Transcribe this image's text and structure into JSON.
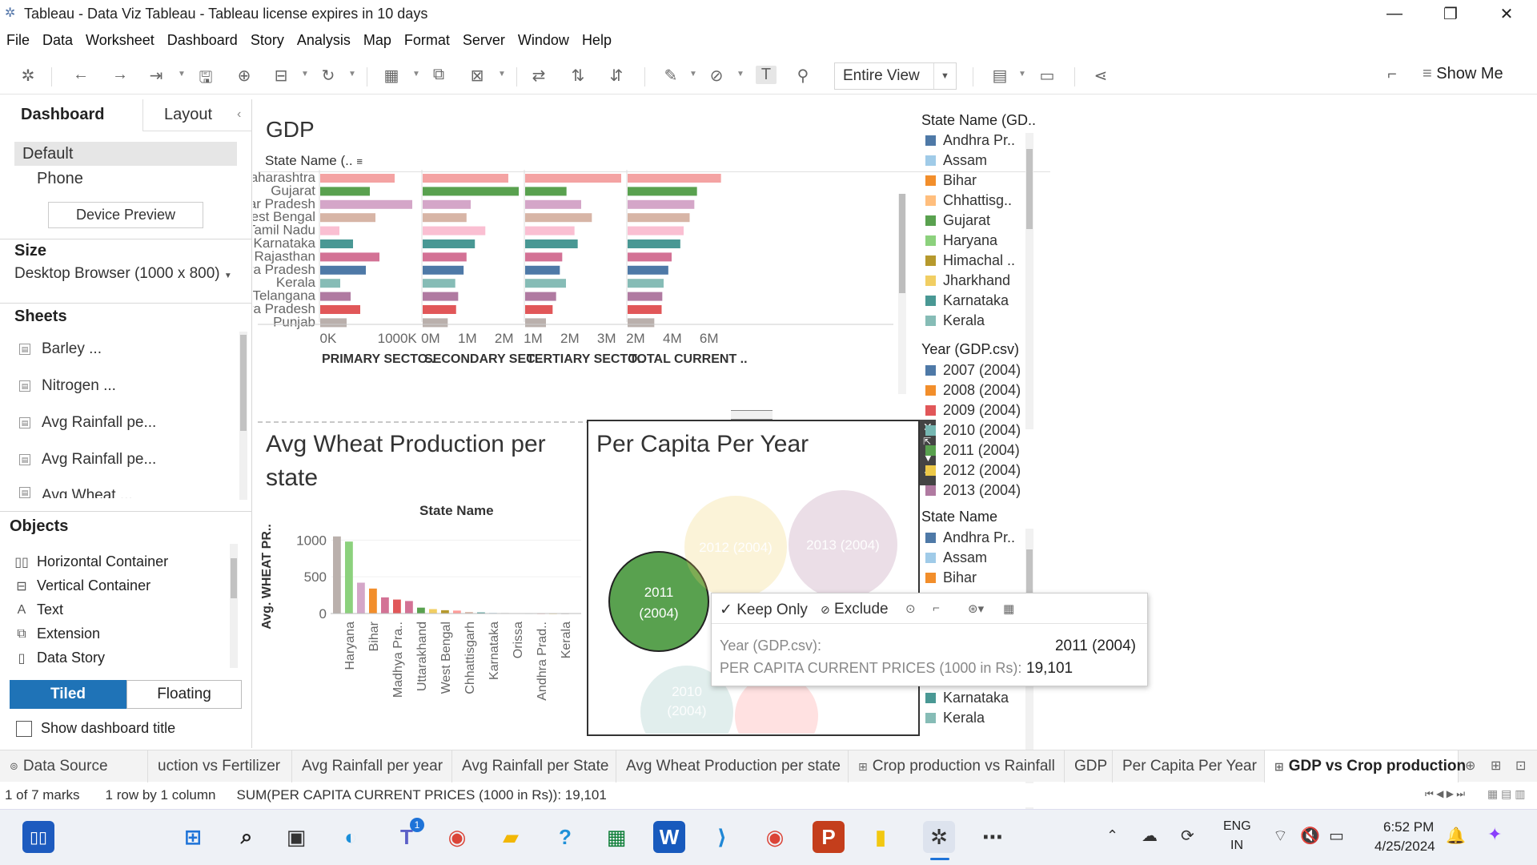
{
  "window": {
    "title": "Tableau - Data Viz Tableau - Tableau license expires in 10 days"
  },
  "menu": [
    "File",
    "Data",
    "Worksheet",
    "Dashboard",
    "Story",
    "Analysis",
    "Map",
    "Format",
    "Server",
    "Window",
    "Help"
  ],
  "toolbar": {
    "view_select": "Entire View",
    "show_me": "Show Me"
  },
  "left_pane": {
    "tabs": [
      "Dashboard",
      "Layout"
    ],
    "devices": [
      "Default",
      "Phone"
    ],
    "device_preview": "Device Preview",
    "size_label": "Size",
    "size_value": "Desktop Browser (1000 x 800)",
    "sheets_label": "Sheets",
    "sheets": [
      "Barley ...",
      "Nitrogen ...",
      "Avg Rainfall pe...",
      "Avg Rainfall pe...",
      "Avg Wheat ..."
    ],
    "objects_label": "Objects",
    "objects": [
      "Horizontal Container",
      "Vertical Container",
      "Text",
      "Extension",
      "Data Story"
    ],
    "tiled": "Tiled",
    "floating": "Floating",
    "show_title": "Show dashboard title"
  },
  "gdp_chart": {
    "title": "GDP",
    "row_header": "State Name (..",
    "states": [
      "Maharashtra",
      "Gujarat",
      "Uttar Pradesh",
      "West Bengal",
      "Tamil Nadu",
      "Karnataka",
      "Rajasthan",
      "Andhra Pradesh",
      "Kerala",
      "Telangana",
      "Madhya Pradesh",
      "Punjab"
    ],
    "colors": [
      "#f4a3a3",
      "#59a14f",
      "#d4a6c8",
      "#d7b5a6",
      "#fabfd2",
      "#499894",
      "#d37295",
      "#4e79a7",
      "#86bcb6",
      "#b07aa1",
      "#e15759",
      "#bab0ac"
    ],
    "columns": [
      {
        "name": "PRIMARY SECTO..",
        "ticks": [
          "0K",
          "1000K"
        ],
        "max": 1200,
        "values": [
          930,
          620,
          1150,
          690,
          240,
          410,
          740,
          570,
          250,
          380,
          500,
          330
        ]
      },
      {
        "name": "SECONDARY SEC..",
        "ticks": [
          "0M",
          "1M",
          "2M"
        ],
        "max": 2.3,
        "values": [
          2.05,
          2.3,
          1.15,
          1.05,
          1.5,
          1.25,
          1.05,
          0.98,
          0.78,
          0.85,
          0.8,
          0.6
        ]
      },
      {
        "name": "TERTIARY SECTO..",
        "ticks": [
          "1M",
          "2M",
          "3M"
        ],
        "max": 3.6,
        "values": [
          3.6,
          1.55,
          2.1,
          2.5,
          1.85,
          1.97,
          1.39,
          1.3,
          1.53,
          1.16,
          1.03,
          0.78
        ]
      },
      {
        "name": "TOTAL CURRENT ..",
        "ticks": [
          "2M",
          "4M",
          "6M"
        ],
        "max": 7.2,
        "values": [
          7.0,
          5.2,
          5.0,
          4.65,
          4.2,
          3.95,
          3.3,
          3.05,
          2.7,
          2.6,
          2.55,
          2.0
        ]
      }
    ]
  },
  "wheat_chart": {
    "title": "Avg Wheat Production per state",
    "header": "State Name",
    "ylabel": "Avg. WHEAT PR..",
    "yticks": [
      "1000",
      "500",
      "0"
    ],
    "ymax": 1200,
    "states": [
      "",
      "Haryana",
      "",
      "Bihar",
      "",
      "Madhya Pra..",
      "",
      "Uttarakhand",
      "",
      "West Bengal",
      "",
      "Chhattisgarh",
      "",
      "Karnataka",
      "",
      "Orissa",
      "",
      "Andhra Prad..",
      "",
      "Kerala"
    ],
    "values": [
      1050,
      980,
      420,
      340,
      220,
      190,
      170,
      80,
      60,
      45,
      40,
      20,
      15,
      8,
      6,
      4,
      3,
      2,
      1,
      1
    ],
    "colors": [
      "#bab0ac",
      "#8cd17d",
      "#d4a6c8",
      "#f28e2b",
      "#d37295",
      "#e15759",
      "#d37295",
      "#59a14f",
      "#f1ce63",
      "#b6992d",
      "#ff9d9a",
      "#d7b5a6",
      "#499894",
      "#a0cbe8",
      "#79706e",
      "#86bcb6",
      "#4e79a7",
      "#e15759",
      "#f1ce63",
      "#bab0ac"
    ]
  },
  "bubble_chart": {
    "title": "Per Capita Per Year",
    "bubbles": [
      {
        "label": "2011 (2004)",
        "color": "#59a14f",
        "faded": false
      },
      {
        "label": "2012 (2004)",
        "color": "#f1ce63",
        "faded": true
      },
      {
        "label": "2013 (2004)",
        "color": "#b07aa1",
        "faded": true
      },
      {
        "label": "2010 (2004)",
        "color": "#86bcb6",
        "faded": true
      }
    ]
  },
  "legend_state": {
    "title": "State Name (GD..",
    "items": [
      "Andhra Pr..",
      "Assam",
      "Bihar",
      "Chhattisg..",
      "Gujarat",
      "Haryana",
      "Himachal ..",
      "Jharkhand",
      "Karnataka",
      "Kerala"
    ],
    "colors": [
      "#4e79a7",
      "#a0cbe8",
      "#f28e2b",
      "#ffbe7d",
      "#59a14f",
      "#8cd17d",
      "#b6992d",
      "#f1ce63",
      "#499894",
      "#86bcb6"
    ]
  },
  "legend_year": {
    "title": "Year (GDP.csv)",
    "items": [
      "2007 (2004)",
      "2008 (2004)",
      "2009 (2004)",
      "2010 (2004)",
      "2011 (2004)",
      "2012 (2004)",
      "2013 (2004)"
    ],
    "colors": [
      "#4e79a7",
      "#f28e2b",
      "#e15759",
      "#76b7b2",
      "#59a14f",
      "#edc948",
      "#b07aa1"
    ]
  },
  "legend_state2": {
    "title": "State Name",
    "items": [
      "Andhra Pr..",
      "Assam",
      "Bihar",
      "Karnataka",
      "Kerala"
    ],
    "colors": [
      "#4e79a7",
      "#a0cbe8",
      "#f28e2b",
      "#499894",
      "#86bcb6"
    ]
  },
  "tooltip": {
    "keep_only": "Keep Only",
    "exclude": "Exclude",
    "row1_label": "Year (GDP.csv):",
    "row1_value": "2011 (2004)",
    "row2_label": "PER CAPITA CURRENT PRICES (1000 in Rs):",
    "row2_value": "19,101"
  },
  "sheet_tabs": [
    "Data Source",
    "uction vs Fertilizer",
    "Avg Rainfall per year",
    "Avg Rainfall per State",
    "Avg Wheat Production per state",
    "Crop production vs Rainfall",
    "GDP",
    "Per Capita Per Year",
    "GDP vs Crop production"
  ],
  "status": {
    "marks": "1 of 7 marks",
    "rows": "1 row by 1 column",
    "sum": "SUM(PER CAPITA CURRENT PRICES (1000 in Rs)): 19,101"
  },
  "taskbar": {
    "lang1": "ENG",
    "lang2": "IN",
    "time": "6:52 PM",
    "date": "4/25/2024",
    "teams_badge": "1"
  }
}
